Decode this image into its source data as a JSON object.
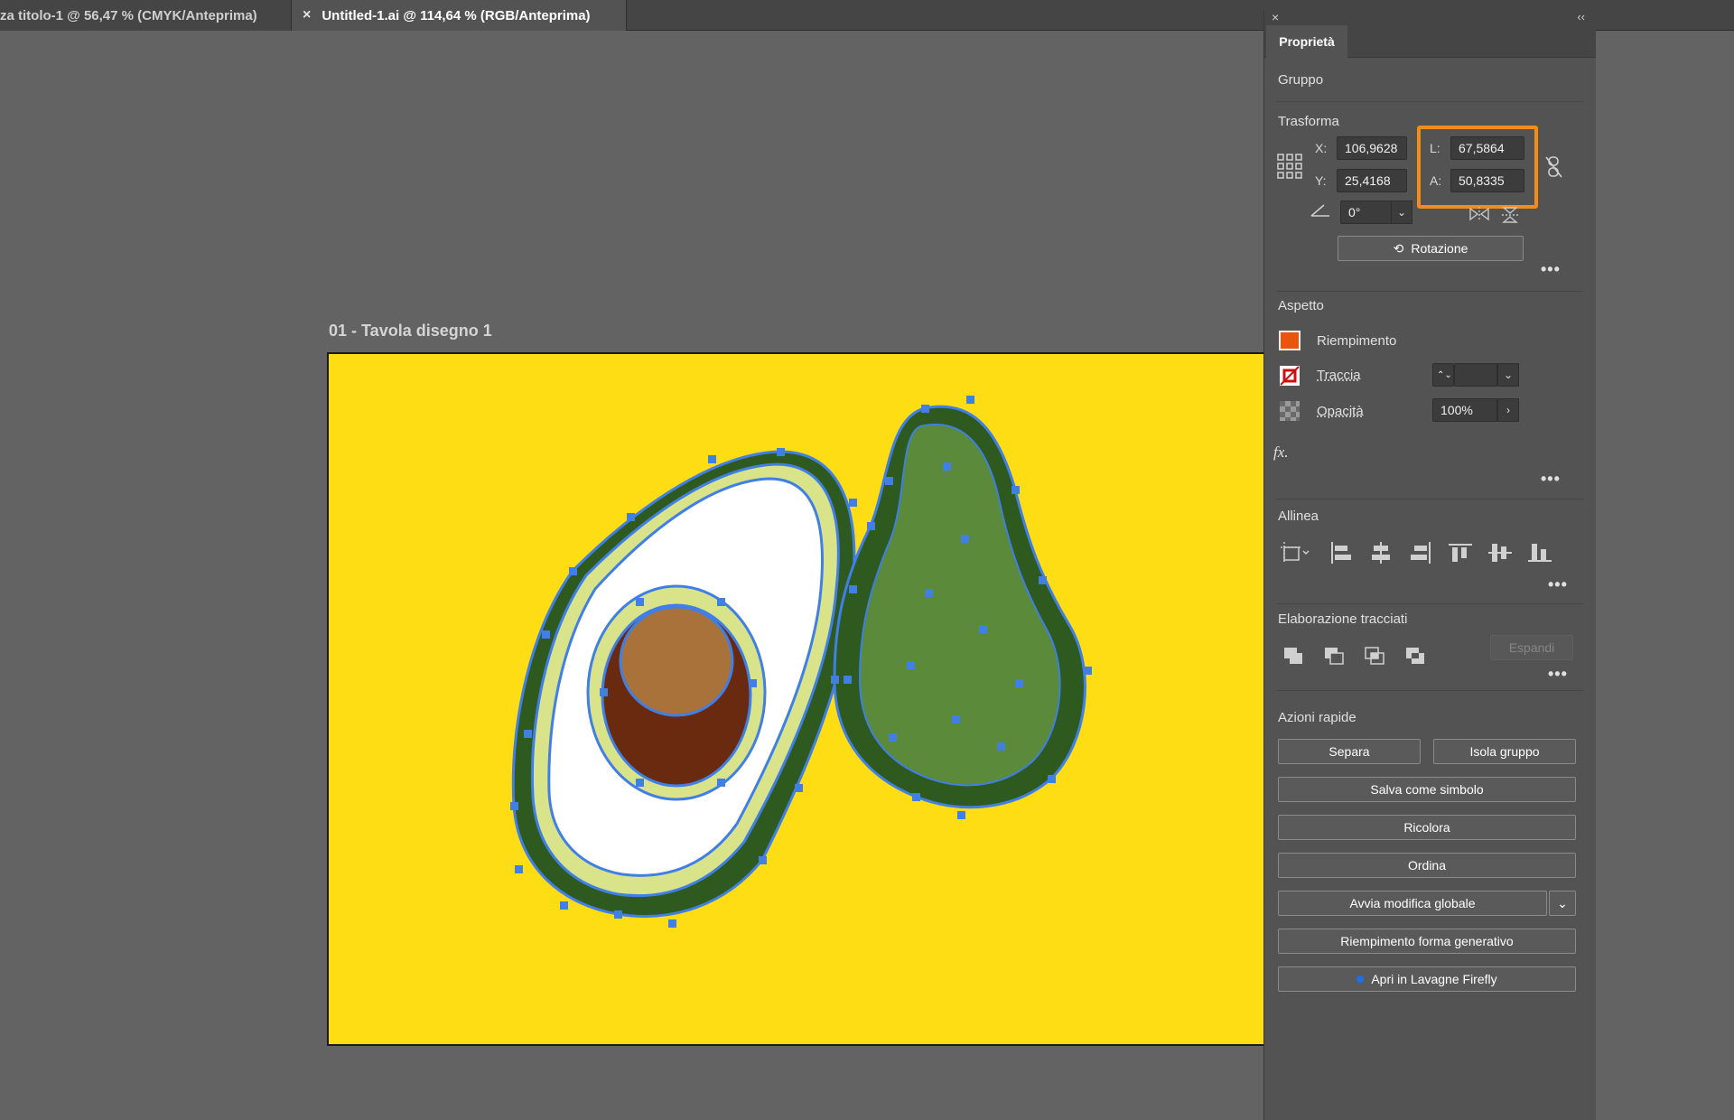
{
  "tabs": [
    {
      "label": "za titolo-1 @ 56,47 % (CMYK/Anteprima)",
      "active": false
    },
    {
      "label": "Untitled-1.ai @ 114,64 % (RGB/Anteprima)",
      "active": true,
      "close": "×"
    }
  ],
  "artboard": {
    "label": "01 - Tavola disegno 1",
    "background": "#ffdd15"
  },
  "panel": {
    "tab": "Proprietà",
    "selection": "Gruppo",
    "transform": {
      "title": "Trasforma",
      "x_label": "X:",
      "x_value": "106,9628",
      "y_label": "Y:",
      "y_value": "25,4168",
      "w_label": "L:",
      "w_value": "67,5864",
      "h_label": "A:",
      "h_value": "50,8335",
      "angle_value": "0°",
      "rotation_button": "Rotazione"
    },
    "appearance": {
      "title": "Aspetto",
      "fill_label": "Riempimento",
      "fill_color": "#e8550f",
      "stroke_label": "Traccia",
      "opacity_label": "Opacità",
      "opacity_value": "100%",
      "fx": "fx."
    },
    "align": {
      "title": "Allinea"
    },
    "pathfinder": {
      "title": "Elaborazione tracciati",
      "expand_button": "Espandi"
    },
    "quick_actions": {
      "title": "Azioni rapide",
      "buttons": {
        "separate": "Separa",
        "isolate": "Isola gruppo",
        "save_symbol": "Salva come simbolo",
        "recolor": "Ricolora",
        "arrange": "Ordina",
        "global_edit": "Avvia modifica globale",
        "generative_fill": "Riempimento forma generativo",
        "firefly": "Apri in Lavagne Firefly"
      }
    },
    "more": "•••"
  },
  "colors": {
    "highlight": "#f28c1b",
    "selection": "#3f7fe6"
  }
}
